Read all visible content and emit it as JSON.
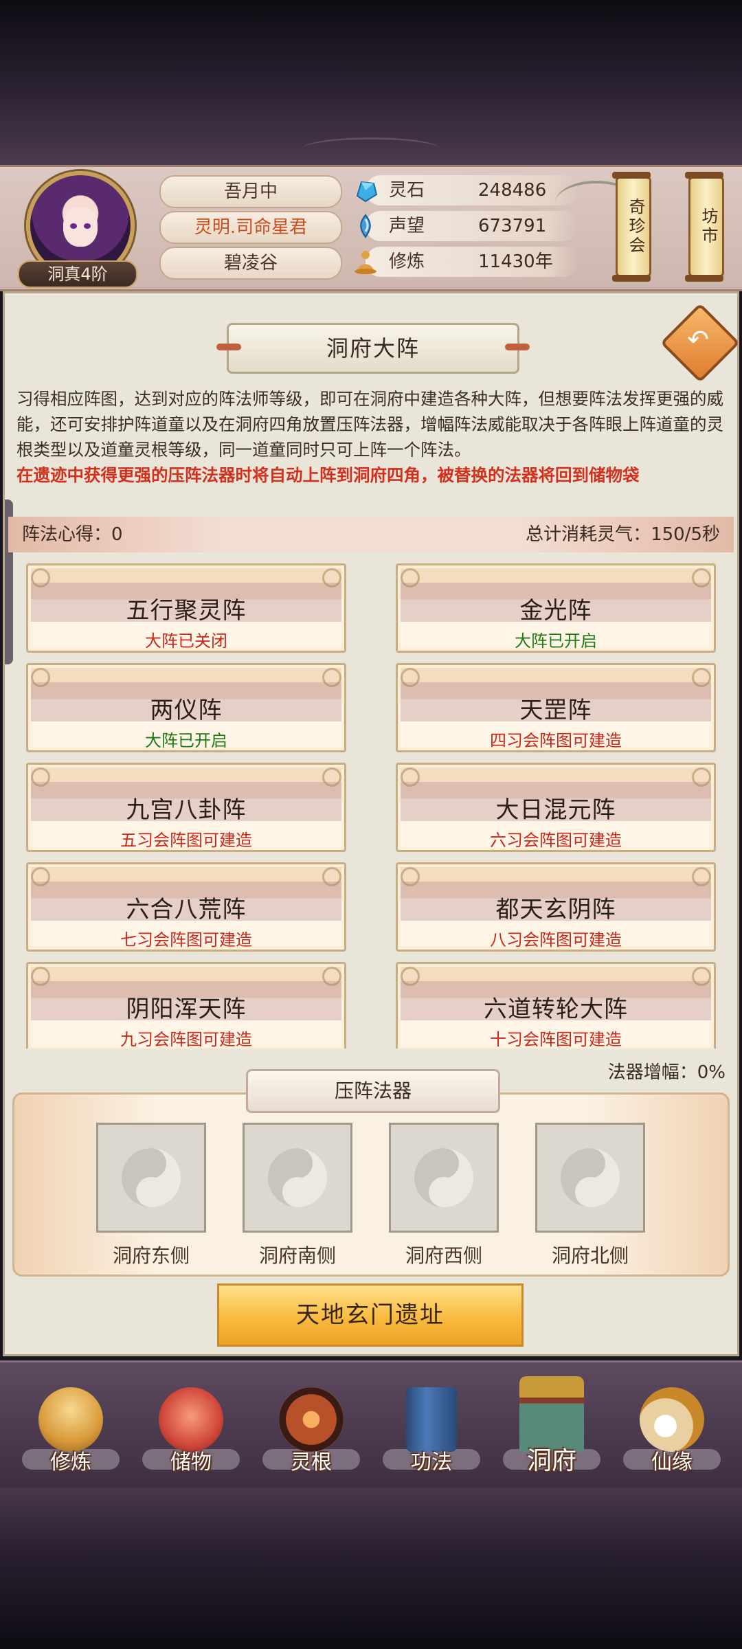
{
  "header": {
    "rank": "洞真4阶",
    "player_name": "吾月中",
    "player_title": "灵明.司命星君",
    "sect": "碧凌谷",
    "stats": [
      {
        "icon": "spirit-stone-icon",
        "label": "灵石",
        "value": "248486"
      },
      {
        "icon": "reputation-icon",
        "label": "声望",
        "value": "673791"
      },
      {
        "icon": "cultivation-icon",
        "label": "修炼",
        "value": "11430年"
      }
    ],
    "shop_button": "奇珍会",
    "market_button": "坊市"
  },
  "page": {
    "title": "洞府大阵",
    "description": "习得相应阵图，达到对应的阵法师等级，即可在洞府中建造各种大阵，但想要阵法发挥更强的威能，还可安排护阵道童以及在洞府四角放置压阵法器，增幅阵法威能取决于各阵眼上阵道童的灵根类型以及道童灵根等级，同一道童同时只可上阵一个阵法。",
    "notice": "在遗迹中获得更强的压阵法器时将自动上阵到洞府四角，被替换的法器将回到储物袋",
    "insight": "阵法心得：0",
    "consumption": "总计消耗灵气：150/5秒"
  },
  "formations": [
    {
      "name": "五行聚灵阵",
      "status": "大阵已关闭",
      "color": "#c8281c"
    },
    {
      "name": "金光阵",
      "status": "大阵已开启",
      "color": "#1e7a14"
    },
    {
      "name": "两仪阵",
      "status": "大阵已开启",
      "color": "#1e7a14"
    },
    {
      "name": "天罡阵",
      "status": "四习会阵图可建造",
      "color": "#c8281c"
    },
    {
      "name": "九宫八卦阵",
      "status": "五习会阵图可建造",
      "color": "#c8281c"
    },
    {
      "name": "大日混元阵",
      "status": "六习会阵图可建造",
      "color": "#c8281c"
    },
    {
      "name": "六合八荒阵",
      "status": "七习会阵图可建造",
      "color": "#c8281c"
    },
    {
      "name": "都天玄阴阵",
      "status": "八习会阵图可建造",
      "color": "#c8281c"
    },
    {
      "name": "阴阳浑天阵",
      "status": "九习会阵图可建造",
      "color": "#c8281c"
    },
    {
      "name": "六道转轮大阵",
      "status": "十习会阵图可建造",
      "color": "#c8281c"
    }
  ],
  "artifacts": {
    "boost": "法器增幅：0%",
    "title": "压阵法器",
    "slots": [
      "洞府东侧",
      "洞府南侧",
      "洞府西侧",
      "洞府北侧"
    ],
    "ruins_button": "天地玄门遗址"
  },
  "nav": [
    {
      "label": "修炼",
      "icon": "cultivate-icon",
      "color": "#d89a3a"
    },
    {
      "label": "储物",
      "icon": "storage-bag-icon",
      "color": "#d0483a"
    },
    {
      "label": "灵根",
      "icon": "spirit-root-icon",
      "color": "#b8502a"
    },
    {
      "label": "功法",
      "icon": "technique-book-icon",
      "color": "#3a6aa8"
    },
    {
      "label": "洞府",
      "icon": "cave-residence-icon",
      "color": "#c89a3a"
    },
    {
      "label": "仙缘",
      "icon": "immortal-fate-icon",
      "color": "#e8d0a0"
    }
  ]
}
